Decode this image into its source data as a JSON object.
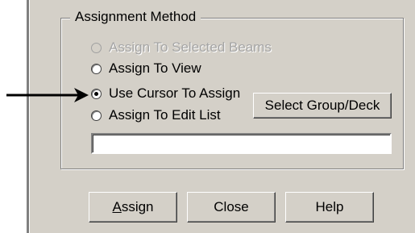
{
  "group": {
    "title": "Assignment Method",
    "options": [
      {
        "label": "Assign To Selected Beams",
        "selected": false,
        "disabled": true
      },
      {
        "label": "Assign To View",
        "selected": false,
        "disabled": false
      },
      {
        "label": "Use Cursor To Assign",
        "selected": true,
        "disabled": false
      },
      {
        "label": "Assign To Edit List",
        "selected": false,
        "disabled": false
      }
    ],
    "select_group_button": "Select Group/Deck",
    "edit_list_value": ""
  },
  "buttons": {
    "assign_mnemonic": "A",
    "assign_rest": "ssign",
    "close": "Close",
    "help": "Help"
  },
  "colors": {
    "dialog_bg": "#d4d0c8",
    "disabled_text": "#a5a5a5"
  },
  "annotation": {
    "arrow_icon": "right-arrow-icon"
  }
}
